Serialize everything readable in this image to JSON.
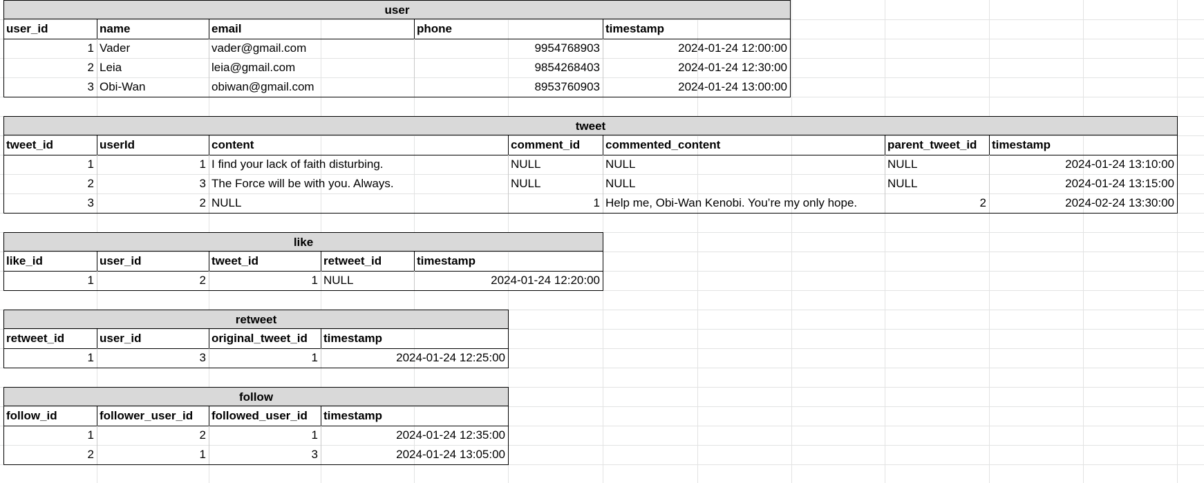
{
  "tables": [
    {
      "key": "user",
      "title": "user",
      "columns": [
        "user_id",
        "name",
        "email",
        "phone",
        "timestamp"
      ],
      "numeric": [
        true,
        false,
        false,
        true,
        true
      ],
      "rows": [
        [
          "1",
          "Vader",
          "vader@gmail.com",
          "9954768903",
          "2024-01-24 12:00:00"
        ],
        [
          "2",
          "Leia",
          "leia@gmail.com",
          "9854268403",
          "2024-01-24 12:30:00"
        ],
        [
          "3",
          "Obi-Wan",
          "obiwan@gmail.com",
          "8953760903",
          "2024-01-24 13:00:00"
        ]
      ]
    },
    {
      "key": "tweet",
      "title": "tweet",
      "columns": [
        "tweet_id",
        "userId",
        "content",
        "comment_id",
        "commented_content",
        "parent_tweet_id",
        "timestamp"
      ],
      "numeric": [
        true,
        true,
        false,
        true,
        false,
        true,
        true
      ],
      "rows": [
        [
          "1",
          "1",
          "I find your lack of faith disturbing.",
          "NULL",
          "NULL",
          "NULL",
          "2024-01-24 13:10:00"
        ],
        [
          "2",
          "3",
          "The Force will be with you. Always.",
          "NULL",
          "NULL",
          "NULL",
          "2024-01-24 13:15:00"
        ],
        [
          "3",
          "2",
          "NULL",
          "1",
          "Help me, Obi-Wan Kenobi. You’re my only hope.",
          "2",
          "2024-02-24 13:30:00"
        ]
      ]
    },
    {
      "key": "like",
      "title": "like",
      "columns": [
        "like_id",
        "user_id",
        "tweet_id",
        "retweet_id",
        "timestamp"
      ],
      "numeric": [
        true,
        true,
        true,
        true,
        true
      ],
      "rows": [
        [
          "1",
          "2",
          "1",
          "NULL",
          "2024-01-24 12:20:00"
        ]
      ]
    },
    {
      "key": "retweet",
      "title": "retweet",
      "columns": [
        "retweet_id",
        "user_id",
        "original_tweet_id",
        "timestamp"
      ],
      "numeric": [
        true,
        true,
        true,
        true
      ],
      "rows": [
        [
          "1",
          "3",
          "1",
          "2024-01-24 12:25:00"
        ]
      ]
    },
    {
      "key": "follow",
      "title": "follow",
      "columns": [
        "follow_id",
        "follower_user_id",
        "followed_user_id",
        "timestamp"
      ],
      "numeric": [
        true,
        true,
        true,
        true
      ],
      "rows": [
        [
          "1",
          "2",
          "1",
          "2024-01-24 12:35:00"
        ],
        [
          "2",
          "1",
          "3",
          "2024-01-24 13:05:00"
        ]
      ]
    }
  ]
}
